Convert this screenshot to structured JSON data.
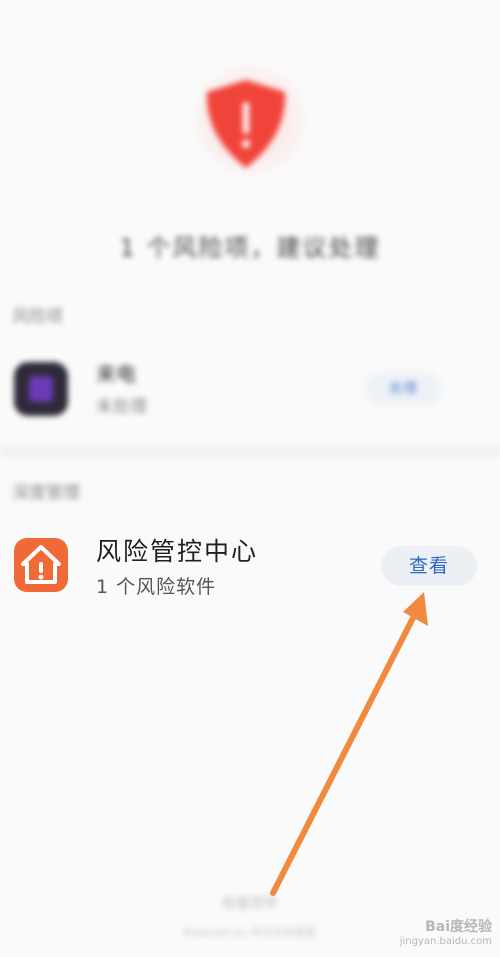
{
  "header": {
    "risk_summary": "1 个风险项，建议处理"
  },
  "sections": {
    "risk_apps_label": "风险项",
    "deep_manage_label": "深度管理"
  },
  "risk_app": {
    "name": "来电",
    "status": "未处理",
    "action_label": "处理"
  },
  "risk_center": {
    "name": "风险管控中心",
    "subtitle": "1 个风险软件",
    "action_label": "查看"
  },
  "footer": {
    "label": "检查完毕",
    "small": "Powered by 华为手机管家"
  },
  "watermark": {
    "brand": "Bai度经验",
    "url": "jingyan.baidu.com"
  },
  "colors": {
    "shield": "#f0443b",
    "risk_center_icon": "#ef6a36",
    "arrow": "#f08a3e",
    "button_text": "#2d66c8"
  }
}
